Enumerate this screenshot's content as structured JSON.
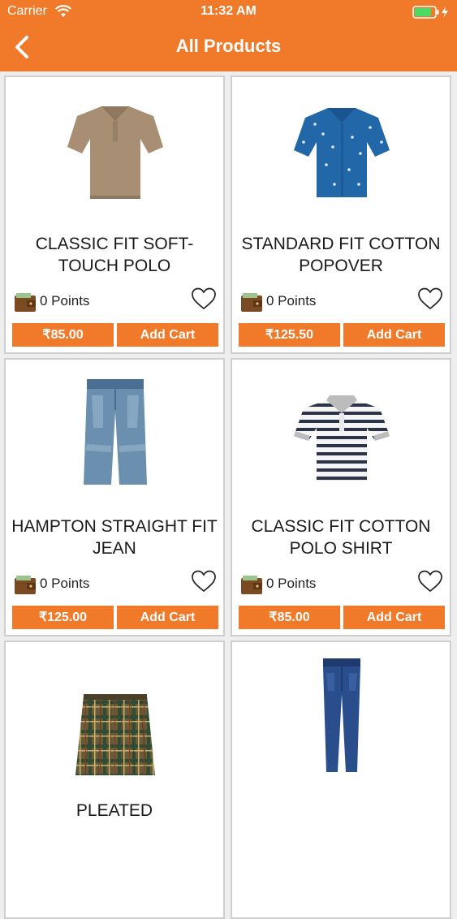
{
  "status": {
    "carrier": "Carrier",
    "time": "11:32 AM"
  },
  "header": {
    "title": "All Products",
    "back_icon": "chevron-left-icon"
  },
  "products": [
    {
      "name": "CLASSIC FIT SOFT-TOUCH POLO",
      "points": "0 Points",
      "price": "₹85.00",
      "cart_label": "Add Cart",
      "image": "tan-polo-shirt"
    },
    {
      "name": "STANDARD FIT COTTON POPOVER",
      "points": "0 Points",
      "price": "₹125.50",
      "cart_label": "Add Cart",
      "image": "blue-print-shirt"
    },
    {
      "name": "HAMPTON STRAIGHT FIT JEAN",
      "points": "0 Points",
      "price": "₹125.00",
      "cart_label": "Add Cart",
      "image": "light-wash-jeans"
    },
    {
      "name": "CLASSIC FIT COTTON POLO SHIRT",
      "points": "0 Points",
      "price": "₹85.00",
      "cart_label": "Add Cart",
      "image": "striped-polo-shirt"
    },
    {
      "name": "PLEATED",
      "image": "plaid-skirt"
    },
    {
      "name": "",
      "image": "dark-skinny-jeans"
    }
  ],
  "colors": {
    "accent": "#f07a2a",
    "card_border": "#cfcfcf",
    "background": "#eeeeee"
  }
}
